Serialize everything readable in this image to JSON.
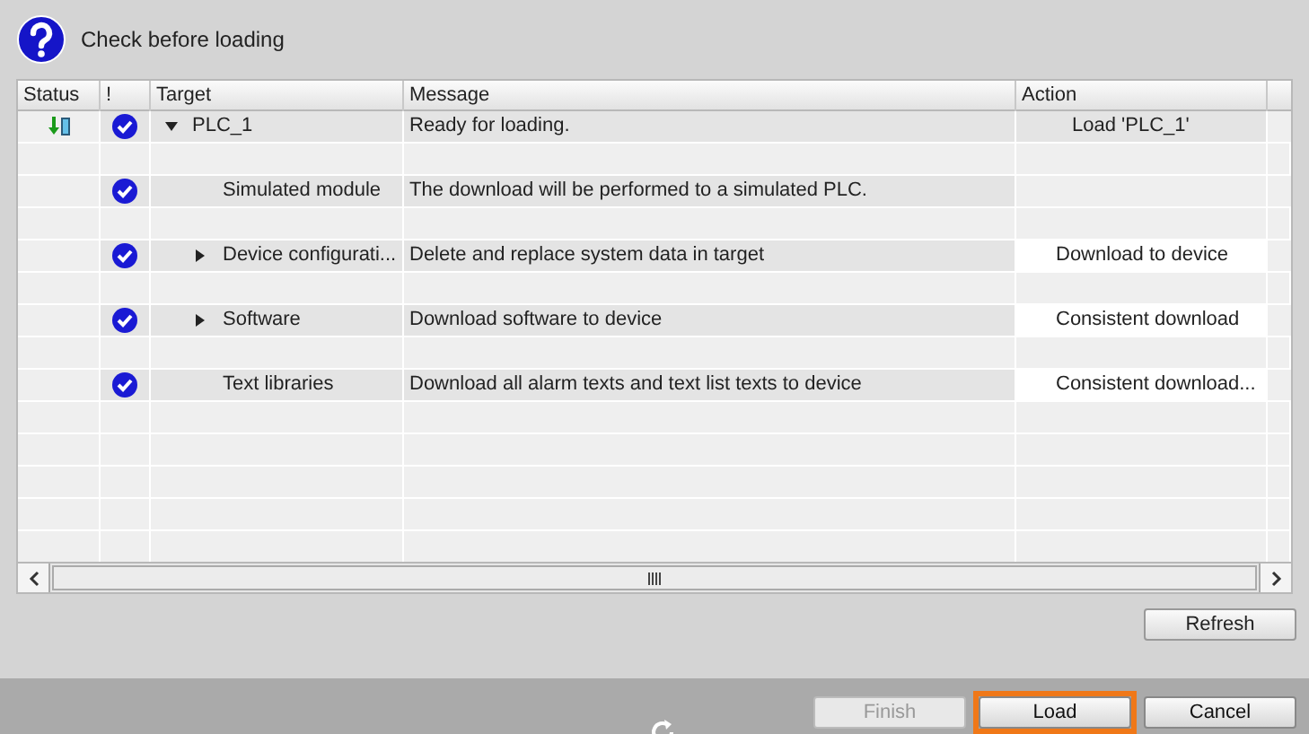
{
  "dialog": {
    "title": "Check before loading"
  },
  "table": {
    "columns": [
      "Status",
      "!",
      "Target",
      "Message",
      "Action"
    ],
    "rows": [
      {
        "kind": "download",
        "checked": true,
        "target": "PLC_1",
        "expanded": true,
        "message": "Ready for loading.",
        "action": {
          "kind": "text",
          "label": "Load 'PLC_1'"
        },
        "children": [
          {
            "checked": true,
            "target": "Simulated module",
            "message": "The download will be performed to a simulated PLC."
          },
          {
            "checked": true,
            "target": "Device configurati...",
            "expanded": false,
            "message": "Delete and replace system data in target",
            "action": {
              "kind": "dropdown",
              "label": "Download to device"
            }
          },
          {
            "checked": true,
            "target": "Software",
            "expanded": false,
            "message": "Download software to device",
            "action": {
              "kind": "dropdown",
              "label": "Consistent download"
            }
          },
          {
            "checked": true,
            "target": "Text libraries",
            "message": "Download all alarm texts and text list texts to device",
            "action": {
              "kind": "dropdown",
              "label": "Consistent download..."
            }
          }
        ]
      }
    ]
  },
  "refresh_button": "Refresh",
  "footer_buttons": [
    {
      "label": "Finish",
      "disabled": true,
      "selected": false
    },
    {
      "label": "Load",
      "disabled": false,
      "selected": true
    },
    {
      "label": "Cancel",
      "disabled": false,
      "selected": false
    }
  ]
}
